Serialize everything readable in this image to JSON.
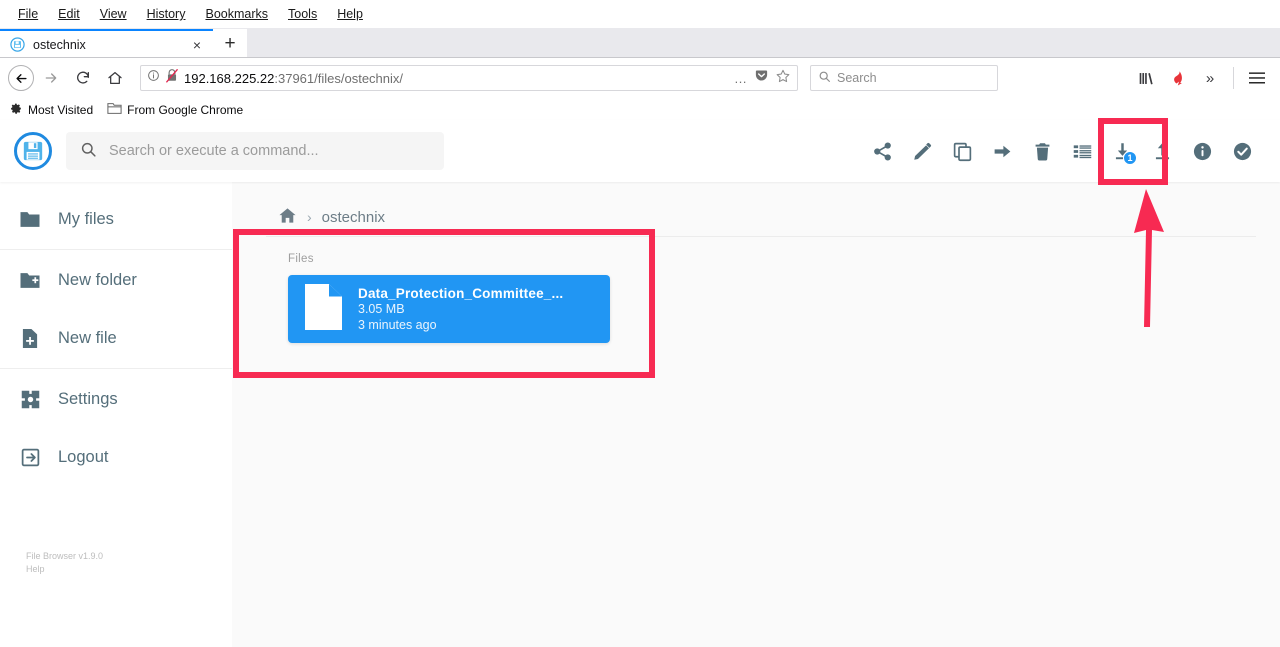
{
  "browser": {
    "menus": [
      {
        "label": "File",
        "accel": "F"
      },
      {
        "label": "Edit",
        "accel": "E"
      },
      {
        "label": "View",
        "accel": "V"
      },
      {
        "label": "History",
        "accel": "s"
      },
      {
        "label": "Bookmarks",
        "accel": "B"
      },
      {
        "label": "Tools",
        "accel": "T"
      },
      {
        "label": "Help",
        "accel": "H"
      }
    ],
    "tab": {
      "title": "ostechnix",
      "favicon_name": "filebrowser-floppy-favicon",
      "close_label": "×",
      "new_tab_label": "+"
    },
    "nav": {
      "back_icon": "←",
      "forward_icon": "→",
      "reload_icon": "⟳",
      "home_icon": "⌂"
    },
    "url": {
      "host": "192.168.225.22",
      "path": ":37961/files/ostechnix/",
      "info_icon": "ⓘ",
      "insecure_icon": "crossed-out-lock",
      "more_icon": "…",
      "pocket_icon": "pocket-shield",
      "bookmark_icon": "☆"
    },
    "search": {
      "placeholder": "Search",
      "icon": "search-icon"
    },
    "right_icons": [
      {
        "name": "library-icon",
        "glyph": "|||\\"
      },
      {
        "name": "downloads-arrow-icon",
        "glyph": "⬇"
      },
      {
        "name": "overflow-chevrons-icon",
        "glyph": "»"
      },
      {
        "name": "hamburger-menu-icon",
        "glyph": "≡"
      }
    ],
    "bookmarks": [
      {
        "label": "Most Visited",
        "icon": "gear-icon"
      },
      {
        "label": "From Google Chrome",
        "icon": "folder-icon"
      }
    ]
  },
  "app": {
    "header": {
      "logo_name": "filebrowser-logo",
      "search_placeholder": "Search or execute a command...",
      "actions": [
        {
          "name": "share-button",
          "title": "Share"
        },
        {
          "name": "rename-button",
          "title": "Rename"
        },
        {
          "name": "copy-button",
          "title": "Copy"
        },
        {
          "name": "move-button",
          "title": "Move"
        },
        {
          "name": "delete-button",
          "title": "Delete"
        },
        {
          "name": "switch-view-button",
          "title": "Switch view"
        },
        {
          "name": "download-button",
          "title": "Download",
          "badge": "1"
        },
        {
          "name": "upload-button",
          "title": "Upload"
        },
        {
          "name": "info-button",
          "title": "Info"
        },
        {
          "name": "select-multiple-button",
          "title": "Select multiple"
        }
      ]
    },
    "sidebar": {
      "items": [
        {
          "label": "My files",
          "icon": "folder-icon"
        },
        {
          "label": "New folder",
          "icon": "folder-plus-icon"
        },
        {
          "label": "New file",
          "icon": "file-plus-icon"
        },
        {
          "label": "Settings",
          "icon": "gear-icon"
        },
        {
          "label": "Logout",
          "icon": "logout-icon"
        }
      ],
      "version": "File Browser v1.9.0",
      "help": "Help"
    },
    "breadcrumb": {
      "home_icon": "home-icon",
      "separator": "›",
      "current": "ostechnix"
    },
    "files": {
      "section_label": "Files",
      "items": [
        {
          "name": "Data_Protection_Committee_...",
          "size": "3.05 MB",
          "modified": "3 minutes ago",
          "selected": true
        }
      ]
    },
    "colors": {
      "accent": "#2196f3",
      "icon": "#546e7a",
      "annotation": "#f72a52"
    }
  }
}
